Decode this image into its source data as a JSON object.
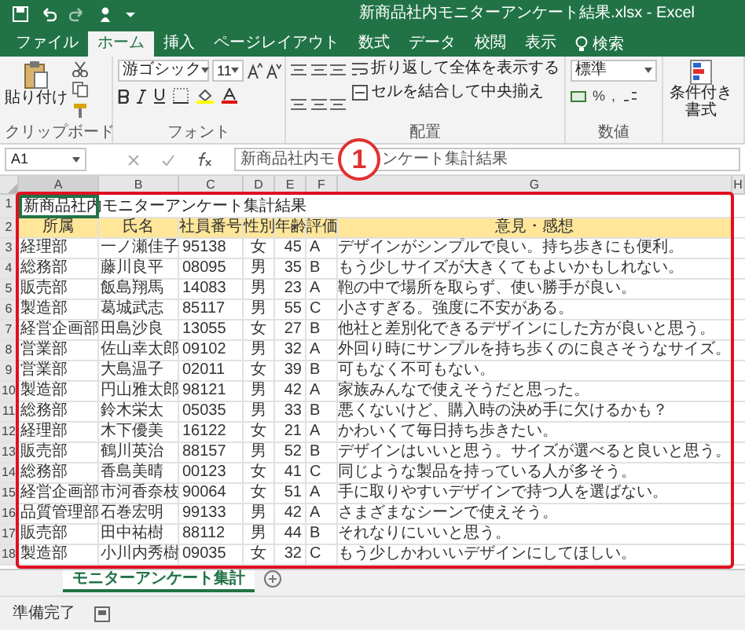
{
  "window": {
    "title": "新商品社内モニターアンケート結果.xlsx - Excel"
  },
  "ribbon_tabs": [
    {
      "label": "ファイル",
      "selected": false
    },
    {
      "label": "ホーム",
      "selected": true
    },
    {
      "label": "挿入",
      "selected": false
    },
    {
      "label": "ページレイアウト",
      "selected": false
    },
    {
      "label": "数式",
      "selected": false
    },
    {
      "label": "データ",
      "selected": false
    },
    {
      "label": "校閲",
      "selected": false
    },
    {
      "label": "表示",
      "selected": false
    }
  ],
  "tell_me": {
    "placeholder": "検索"
  },
  "ribbon": {
    "clipboard": {
      "paste": "貼り付け",
      "label": "クリップボード"
    },
    "font": {
      "name": "游ゴシック",
      "size": "11",
      "label": "フォント"
    },
    "alignment": {
      "wrap": "折り返して全体を表示する",
      "merge": "セルを結合して中央揃え",
      "label": "配置"
    },
    "number": {
      "format": "標準",
      "percent": "%",
      "comma": ",",
      "label": "数値"
    },
    "styles": {
      "conditional": "条件付き書式"
    }
  },
  "formula_bar": {
    "name_box": "A1",
    "value_parts": [
      "新商品社内モ",
      "ンケート集計結果"
    ]
  },
  "callout": {
    "label": "1"
  },
  "columns": [
    "A",
    "B",
    "C",
    "D",
    "E",
    "F",
    "G",
    "H"
  ],
  "sheet": {
    "title": "新商品社内モニターアンケート集計結果",
    "title_selected": true,
    "annotation_frame": true,
    "headers": [
      "所属",
      "氏名",
      "社員番号",
      "性別",
      "年齢",
      "評価",
      "意見・感想"
    ],
    "rows": [
      [
        "経理部",
        "一ノ瀬佳子",
        "95138",
        "女",
        "45",
        "A",
        "デザインがシンプルで良い。持ち歩きにも便利。"
      ],
      [
        "総務部",
        "藤川良平",
        "08095",
        "男",
        "35",
        "B",
        "もう少しサイズが大きくてもよいかもしれない。"
      ],
      [
        "販売部",
        "飯島翔馬",
        "14083",
        "男",
        "23",
        "A",
        "鞄の中で場所を取らず、使い勝手が良い。"
      ],
      [
        "製造部",
        "葛城武志",
        "85117",
        "男",
        "55",
        "C",
        "小さすぎる。強度に不安がある。"
      ],
      [
        "経営企画部",
        "田島沙良",
        "13055",
        "女",
        "27",
        "B",
        "他社と差別化できるデザインにした方が良いと思う。"
      ],
      [
        "営業部",
        "佐山幸太郎",
        "09102",
        "男",
        "32",
        "A",
        "外回り時にサンプルを持ち歩くのに良さそうなサイズ。"
      ],
      [
        "営業部",
        "大島温子",
        "02011",
        "女",
        "39",
        "B",
        "可もなく不可もない。"
      ],
      [
        "製造部",
        "円山雅太郎",
        "98121",
        "男",
        "42",
        "A",
        "家族みんなで使えそうだと思った。"
      ],
      [
        "総務部",
        "鈴木栄太",
        "05035",
        "男",
        "33",
        "B",
        "悪くないけど、購入時の決め手に欠けるかも？"
      ],
      [
        "経理部",
        "木下優美",
        "16122",
        "女",
        "21",
        "A",
        "かわいくて毎日持ち歩きたい。"
      ],
      [
        "販売部",
        "鶴川英治",
        "88157",
        "男",
        "52",
        "B",
        "デザインはいいと思う。サイズが選べると良いと思う。"
      ],
      [
        "総務部",
        "香島美晴",
        "00123",
        "女",
        "41",
        "C",
        "同じような製品を持っている人が多そう。"
      ],
      [
        "経営企画部",
        "市河香奈枝",
        "90064",
        "女",
        "51",
        "A",
        "手に取りやすいデザインで持つ人を選ばない。"
      ],
      [
        "品質管理部",
        "石巻宏明",
        "99133",
        "男",
        "42",
        "A",
        "さまざまなシーンで使えそう。"
      ],
      [
        "販売部",
        "田中祐樹",
        "88112",
        "男",
        "44",
        "B",
        "それなりにいいと思う。"
      ],
      [
        "製造部",
        "小川内秀樹",
        "09035",
        "女",
        "32",
        "C",
        "もう少しかわいいデザインにしてほしい。"
      ]
    ],
    "row_numbers": [
      "1",
      "2",
      "3",
      "4",
      "5",
      "6",
      "7",
      "8",
      "9",
      "10",
      "11",
      "12",
      "13",
      "14",
      "15",
      "16",
      "17",
      "18"
    ]
  },
  "sheet_tabs": [
    {
      "label": "モニターアンケート集計",
      "selected": true
    }
  ],
  "status_bar": {
    "text": "準備完了"
  }
}
